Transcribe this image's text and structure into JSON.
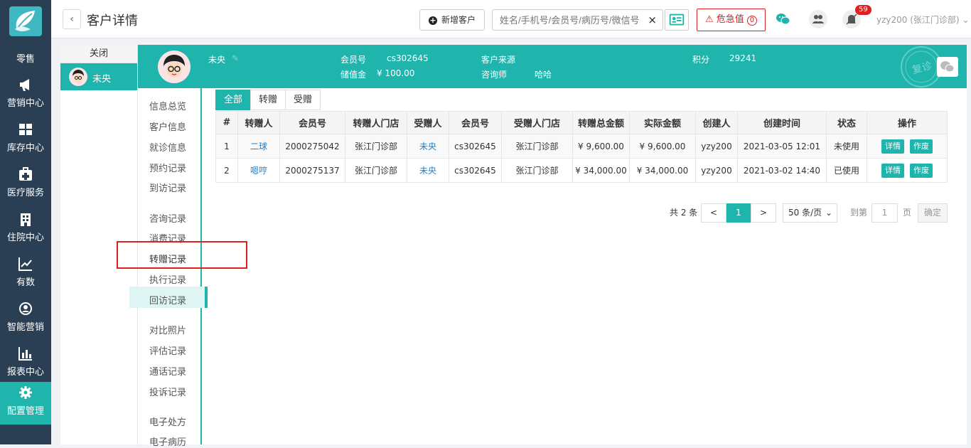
{
  "nav": {
    "items": [
      {
        "label": "零售",
        "icon": "retail-icon"
      },
      {
        "label": "营销中心",
        "icon": "megaphone-icon"
      },
      {
        "label": "库存中心",
        "icon": "grid-icon"
      },
      {
        "label": "医疗服务",
        "icon": "medical-kit-icon"
      },
      {
        "label": "住院中心",
        "icon": "hospital-icon"
      },
      {
        "label": "有数",
        "icon": "line-chart-icon"
      },
      {
        "label": "智能营销",
        "icon": "smart-marketing-icon"
      },
      {
        "label": "报表中心",
        "icon": "bar-chart-icon"
      },
      {
        "label": "配置管理",
        "icon": "gear-icon"
      }
    ]
  },
  "header": {
    "back": "‹",
    "title": "客户详情",
    "add_customer": "新增客户",
    "search_placeholder": "姓名/手机号/会员号/病历号/微信号",
    "clear": "×",
    "danger": "危急值",
    "danger_count": "0",
    "notify_count": "59",
    "user": "yzy200 (张江门诊部)",
    "user_caret": "⌄"
  },
  "tabs": {
    "close": "关闭",
    "customer": "未央"
  },
  "banner": {
    "name": "未央",
    "member_label": "会员号",
    "member_value": "cs302645",
    "balance_label": "储值金",
    "balance_value": "¥ 100.00",
    "source_label": "客户来源",
    "consultant_label": "咨询师",
    "consultant_value": "哈哈",
    "points_label": "积分",
    "points_value": "29241",
    "stamp": "复诊"
  },
  "subnav": {
    "group1": [
      "信息总览",
      "客户信息",
      "就诊信息",
      "预约记录",
      "到访记录"
    ],
    "group2": [
      "咨询记录",
      "消费记录",
      "转赠记录",
      "执行记录",
      "回访记录"
    ],
    "group3": [
      "对比照片",
      "评估记录",
      "通话记录",
      "投诉记录"
    ],
    "group4": [
      "电子处方",
      "电子病历"
    ]
  },
  "filter_tabs": [
    "全部",
    "转赠",
    "受赠"
  ],
  "table": {
    "headers": [
      "#",
      "转赠人",
      "会员号",
      "转赠人门店",
      "受赠人",
      "会员号",
      "受赠人门店",
      "转赠总金额",
      "实际金额",
      "创建人",
      "创建时间",
      "状态",
      "操作"
    ],
    "rows": [
      {
        "no": "1",
        "giver": "二球",
        "giver_no": "2000275042",
        "giver_store": "张江门诊部",
        "receiver": "未央",
        "receiver_no": "cs302645",
        "receiver_store": "张江门诊部",
        "total": "¥ 9,600.00",
        "actual": "¥ 9,600.00",
        "creator": "yzy200",
        "time": "2021-03-05 12:01",
        "status": "未使用"
      },
      {
        "no": "2",
        "giver": "嗯哼",
        "giver_no": "2000275137",
        "giver_store": "张江门诊部",
        "receiver": "未央",
        "receiver_no": "cs302645",
        "receiver_store": "张江门诊部",
        "total": "¥ 34,000.00",
        "actual": "¥ 34,000.00",
        "creator": "yzy200",
        "time": "2021-03-02 14:40",
        "status": "已使用"
      }
    ],
    "op_detail": "详情",
    "op_void": "作废"
  },
  "pagination": {
    "total": "共 2 条",
    "prev": "<",
    "page": "1",
    "next": ">",
    "page_size": "50 条/页",
    "goto_label": "到第",
    "goto_value": "1",
    "page_unit": "页",
    "confirm": "确定"
  },
  "colors": {
    "accent": "#1fb5ad",
    "nav_bg": "#2a3f54",
    "danger": "#e02020",
    "link": "#2a7fbf"
  }
}
